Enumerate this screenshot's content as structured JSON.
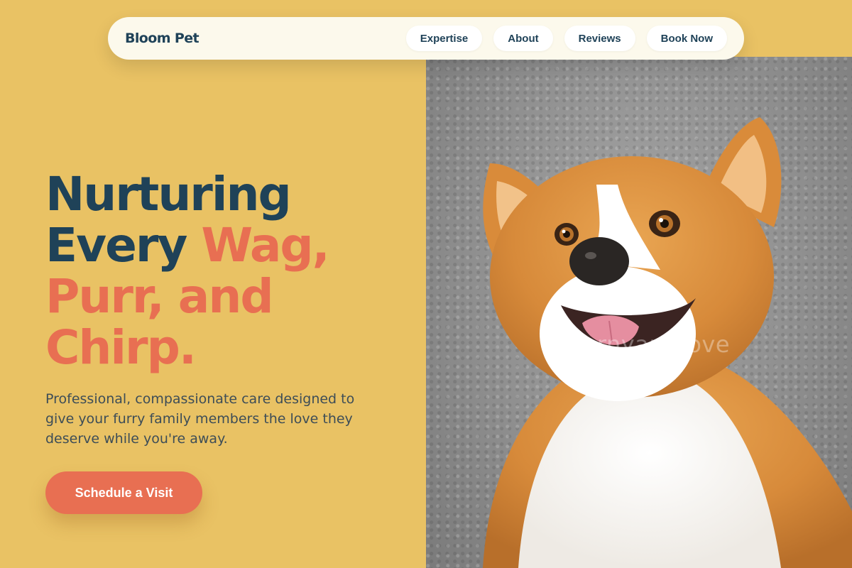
{
  "nav": {
    "brand": "Bloom Pet",
    "links": [
      "Expertise",
      "About",
      "Reviews",
      "Book Now"
    ]
  },
  "hero": {
    "headline_dark_1": "Nurturing",
    "headline_dark_2": "Every ",
    "headline_accent_1": "Wag,",
    "headline_accent_2": "Purr, and",
    "headline_accent_3": "Chirp.",
    "subtitle": "Professional, compassionate care designed to give your furry family members the love they deserve while you're away.",
    "cta_label": "Schedule a Visit"
  },
  "photo": {
    "subject": "corgi-dog-photo",
    "watermark": "barnyard.love"
  },
  "colors": {
    "background": "#e9c264",
    "navy": "#1f4258",
    "coral": "#e86f52",
    "nav_bg": "#fcf9ec"
  }
}
